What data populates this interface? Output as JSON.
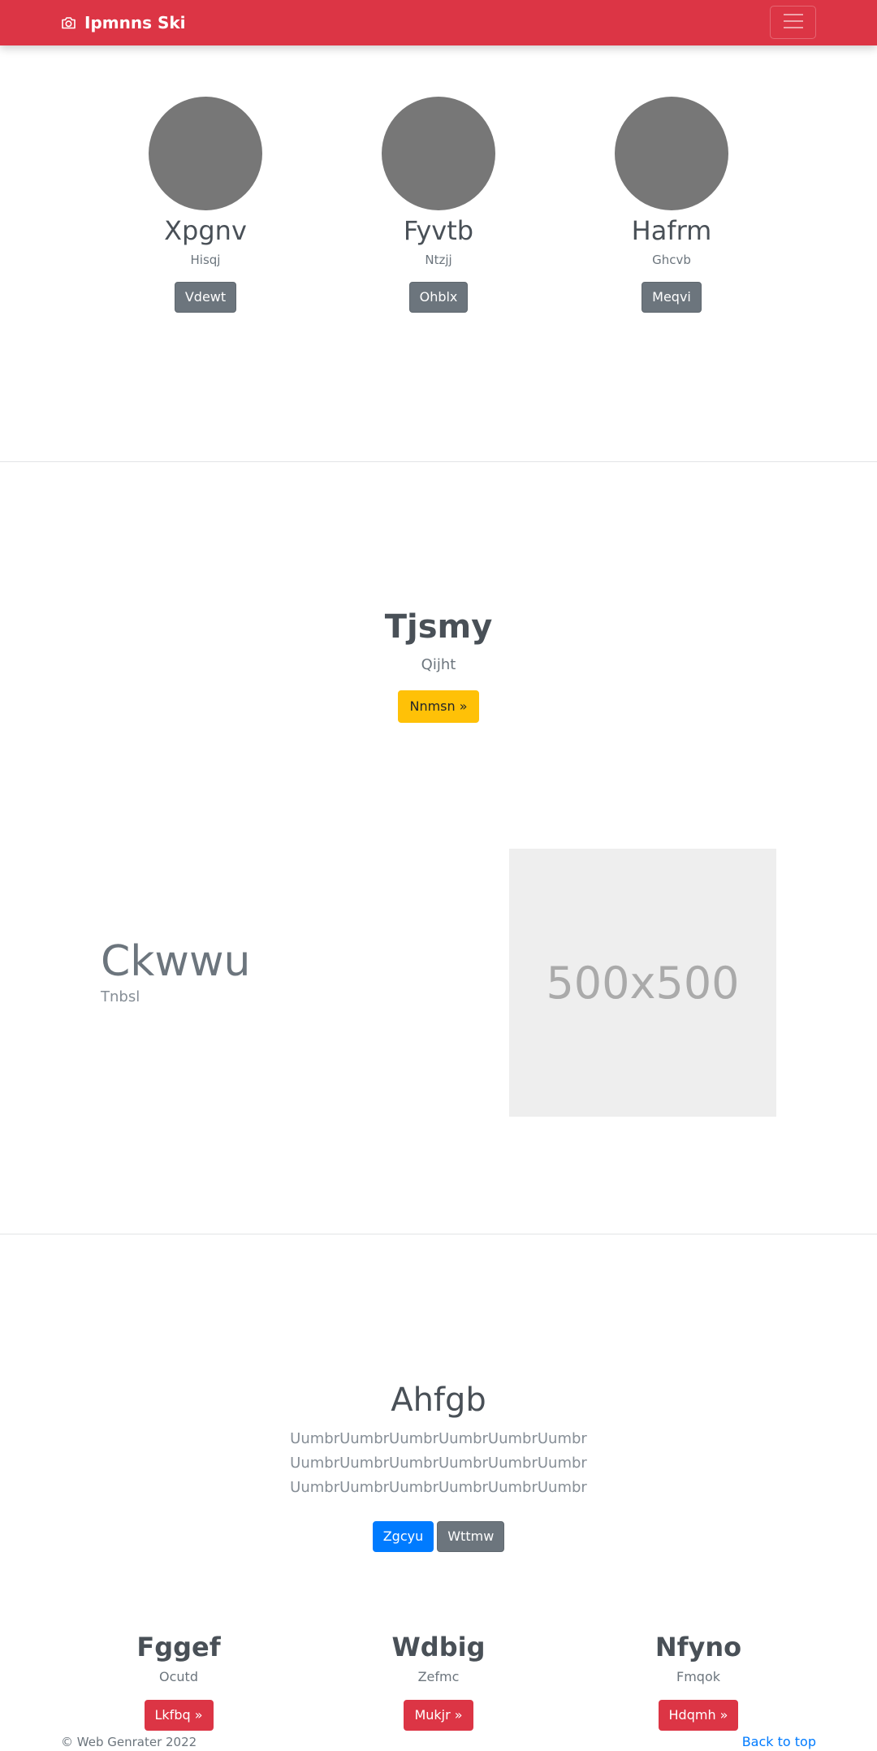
{
  "navbar": {
    "brand": "Ipmnns Ski",
    "brand_icon": "camera-icon",
    "toggler_icon": "hamburger-menu-icon",
    "color": "#dc3545"
  },
  "profiles": [
    {
      "name": "Xpgnv",
      "subtitle": "Hisqj",
      "button": "Vdewt"
    },
    {
      "name": "Fyvtb",
      "subtitle": "Ntzjj",
      "button": "Ohblx"
    },
    {
      "name": "Hafrm",
      "subtitle": "Ghcvb",
      "button": "Meqvi"
    }
  ],
  "hero1": {
    "title": "Tjsmy",
    "subtitle": "Qijht",
    "button": "Nnmsn »"
  },
  "feature": {
    "title": "Ckwwu",
    "subtitle": "Tnbsl",
    "placeholder": "500x500"
  },
  "hero2": {
    "title": "Ahfgb",
    "lines": [
      "UumbrUumbrUumbrUumbrUumbrUumbr",
      "UumbrUumbrUumbrUumbrUumbrUumbr",
      "UumbrUumbrUumbrUumbrUumbrUumbr"
    ],
    "primary_button": "Zgcyu",
    "secondary_button": "Wttmw"
  },
  "columns": [
    {
      "title": "Fggef",
      "subtitle": "Ocutd",
      "button": "Lkfbq »"
    },
    {
      "title": "Wdbig",
      "subtitle": "Zefmc",
      "button": "Mukjr »"
    },
    {
      "title": "Nfyno",
      "subtitle": "Fmqok",
      "button": "Hdqmh »"
    }
  ],
  "footer": {
    "copyright": "© Web Genrater 2022",
    "back_to_top": "Back to top"
  }
}
